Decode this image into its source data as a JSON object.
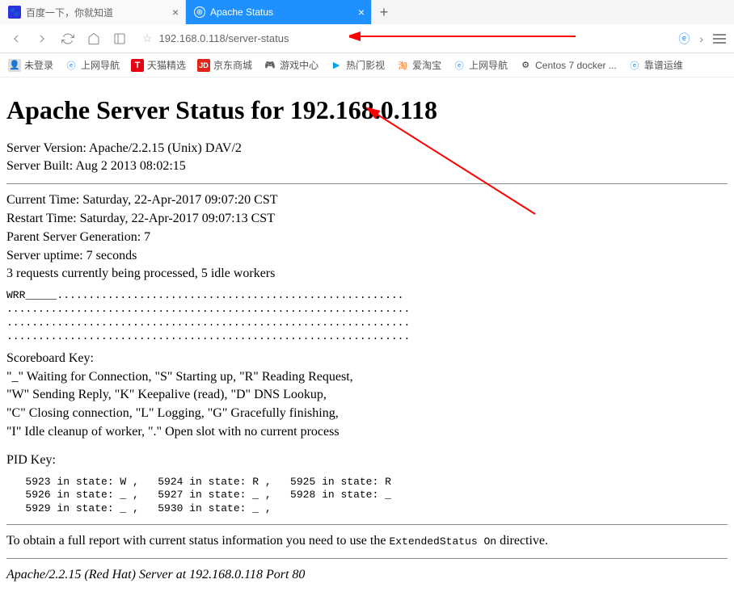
{
  "tabs": {
    "inactive": {
      "title": "百度一下，你就知道"
    },
    "active": {
      "title": "Apache Status"
    }
  },
  "url": "192.168.0.118/server-status",
  "bookmarks": {
    "b0": "未登录",
    "b1": "上网导航",
    "b2": "天猫精选",
    "b3": "京东商城",
    "b4": "游戏中心",
    "b5": "热门影视",
    "b6": "爱淘宝",
    "b7": "上网导航",
    "b8": "Centos 7 docker ...",
    "b9": "靠谱运维"
  },
  "page": {
    "h1": "Apache Server Status for 192.168.0.118",
    "serverVersion": "Server Version: Apache/2.2.15 (Unix) DAV/2",
    "serverBuilt": "Server Built: Aug 2 2013 08:02:15",
    "currentTime": "Current Time: Saturday, 22-Apr-2017 09:07:20 CST",
    "restartTime": "Restart Time: Saturday, 22-Apr-2017 09:07:13 CST",
    "generation": "Parent Server Generation: 7",
    "uptime": "Server uptime: 7 seconds",
    "requests": "3 requests currently being processed, 5 idle workers",
    "scoreboard": "WRR_____.......................................................\n................................................................\n................................................................\n................................................................",
    "keyTitle": "Scoreboard Key:",
    "key1": "\"_\" Waiting for Connection, \"S\" Starting up, \"R\" Reading Request,",
    "key2": "\"W\" Sending Reply, \"K\" Keepalive (read), \"D\" DNS Lookup,",
    "key3": "\"C\" Closing connection, \"L\" Logging, \"G\" Gracefully finishing,",
    "key4": "\"I\" Idle cleanup of worker, \".\" Open slot with no current process",
    "pidTitle": "PID Key:",
    "pids": "   5923 in state: W ,   5924 in state: R ,   5925 in state: R\n   5926 in state: _ ,   5927 in state: _ ,   5928 in state: _\n   5929 in state: _ ,   5930 in state: _ ,",
    "reportPre": "To obtain a full report with current status information you need to use the ",
    "reportCode": "ExtendedStatus On",
    "reportPost": " directive.",
    "footer": "Apache/2.2.15 (Red Hat) Server at 192.168.0.118 Port 80"
  }
}
